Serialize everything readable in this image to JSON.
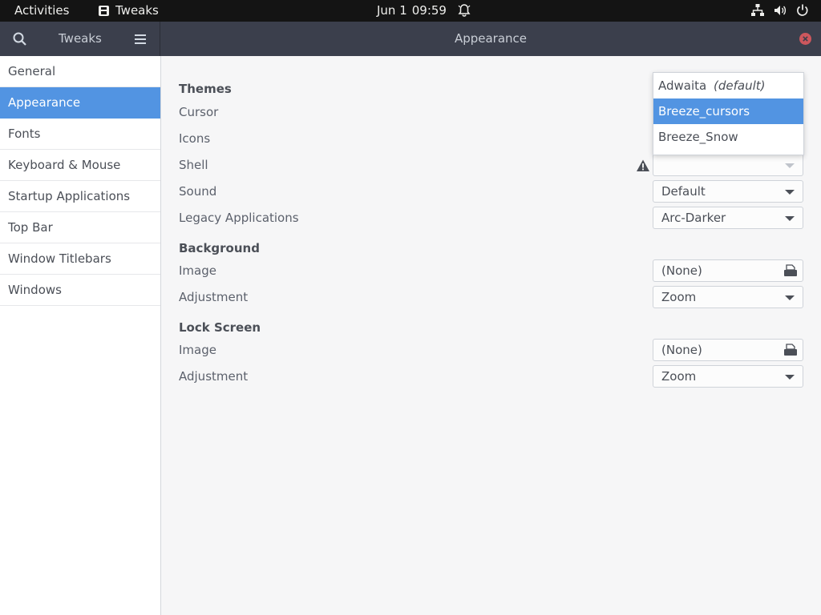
{
  "topbar": {
    "activities": "Activities",
    "app_name": "Tweaks",
    "date": "Jun 1",
    "time": "09:59",
    "icons": [
      "app-icon",
      "bell-icon",
      "network-icon",
      "volume-icon",
      "power-icon"
    ]
  },
  "headerbar": {
    "sidebar_title": "Tweaks",
    "title": "Appearance",
    "close_color": "#cc575d"
  },
  "sidebar": {
    "items": [
      {
        "label": "General"
      },
      {
        "label": "Appearance"
      },
      {
        "label": "Fonts"
      },
      {
        "label": "Keyboard & Mouse"
      },
      {
        "label": "Startup Applications"
      },
      {
        "label": "Top Bar"
      },
      {
        "label": "Window Titlebars"
      },
      {
        "label": "Windows"
      }
    ],
    "active_index": 1,
    "accent": "#5294e2"
  },
  "main": {
    "themes": {
      "heading": "Themes",
      "cursor_label": "Cursor",
      "icons_label": "Icons",
      "shell_label": "Shell",
      "sound_label": "Sound",
      "sound_value": "Default",
      "legacy_label": "Legacy Applications",
      "legacy_value": "Arc-Darker"
    },
    "background": {
      "heading": "Background",
      "image_label": "Image",
      "image_value": "(None)",
      "adjustment_label": "Adjustment",
      "adjustment_value": "Zoom"
    },
    "lock_screen": {
      "heading": "Lock Screen",
      "image_label": "Image",
      "image_value": "(None)",
      "adjustment_label": "Adjustment",
      "adjustment_value": "Zoom"
    }
  },
  "cursor_popup": {
    "options": [
      {
        "label": "Adwaita",
        "suffix": "(default)"
      },
      {
        "label": "Breeze_cursors"
      },
      {
        "label": "Breeze_Snow"
      }
    ],
    "selected_index": 1
  }
}
